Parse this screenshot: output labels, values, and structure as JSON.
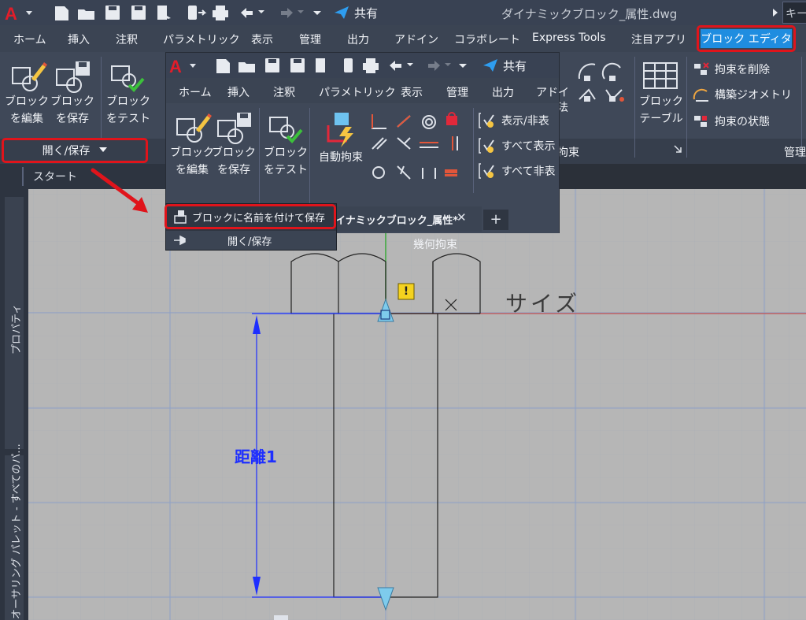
{
  "app": {
    "title": "ダイナミックブロック_属性.dwg",
    "share_label": "共有",
    "search_label": "キー"
  },
  "menu": {
    "tabs": [
      "ホーム",
      "挿入",
      "注釈",
      "パラメトリック",
      "表示",
      "管理",
      "出力",
      "アドイン",
      "コラボレート",
      "Express Tools",
      "注目アプリ",
      "ブロック エディタ"
    ]
  },
  "ribbon": {
    "edit_block": [
      "ブロック",
      "を編集"
    ],
    "save_block": [
      "ブロック",
      "を保存"
    ],
    "test_block": [
      "ブロック",
      "をテスト"
    ],
    "open_save_label": "開く/保存",
    "dimension_partial": "法",
    "constraint_partial": "拘束",
    "block_table": [
      "ブロック",
      "テーブル"
    ],
    "delete_constraint": "拘束を削除",
    "construction_geometry": "構築ジオメトリ",
    "constraint_state": "拘束の状態",
    "manage_partial": "管理"
  },
  "start_tab": "スタート",
  "side_palettes": {
    "properties": "プロパティ",
    "authoring": "オーサリング パレット - すべてのパ..."
  },
  "overlay": {
    "share_label": "共有",
    "menu_tabs": [
      "ホーム",
      "挿入",
      "注釈",
      "パラメトリック",
      "表示",
      "管理",
      "出力",
      "アドイ"
    ],
    "edit_block": [
      "ブロック",
      "を編集"
    ],
    "save_block": [
      "ブロック",
      "を保存"
    ],
    "test_block": [
      "ブロック",
      "をテスト"
    ],
    "auto_constrain": "自動拘束",
    "show_hide": "表示/非表",
    "show_all": "すべて表示",
    "hide_all": "すべて非表",
    "geometric_constraint": "幾何拘束",
    "doc_tab": "イナミックブロック_属性*",
    "new_tab_symbol": "+",
    "close_symbol": "✕"
  },
  "flyout": {
    "save_as": "ブロックに名前を付けて保存",
    "open_save": "開く/保存"
  },
  "drawing": {
    "size_label": "サイズ",
    "distance_label": "距離1",
    "warning_symbol": "!"
  },
  "colors": {
    "highlight": "#e0141b",
    "active_tab": "#1f8de0",
    "dimension": "#1e2fff",
    "grip": "#7ecbec"
  }
}
